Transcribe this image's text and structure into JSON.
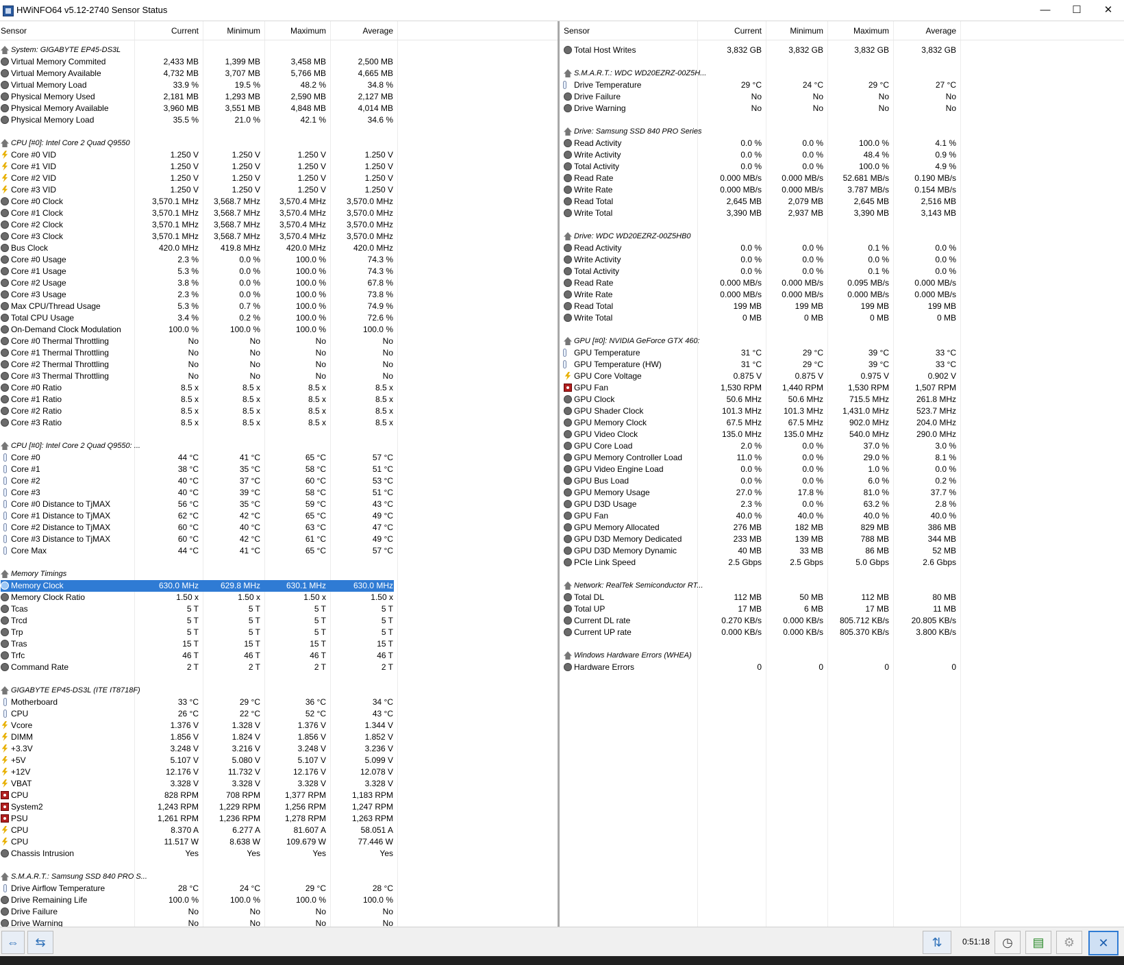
{
  "window": {
    "title": "HWiNFO64 v5.12-2740 Sensor Status",
    "minimize": "—",
    "maximize": "☐",
    "close": "✕"
  },
  "columns": {
    "sensor": "Sensor",
    "current": "Current",
    "minimum": "Minimum",
    "maximum": "Maximum",
    "average": "Average"
  },
  "left": [
    {
      "t": "g",
      "n": "System: GIGABYTE EP45-DS3L"
    },
    {
      "i": "circle",
      "n": "Virtual Memory Commited",
      "v": [
        "2,433 MB",
        "1,399 MB",
        "3,458 MB",
        "2,500 MB"
      ]
    },
    {
      "i": "circle",
      "n": "Virtual Memory Available",
      "v": [
        "4,732 MB",
        "3,707 MB",
        "5,766 MB",
        "4,665 MB"
      ]
    },
    {
      "i": "circle",
      "n": "Virtual Memory Load",
      "v": [
        "33.9 %",
        "19.5 %",
        "48.2 %",
        "34.8 %"
      ]
    },
    {
      "i": "circle",
      "n": "Physical Memory Used",
      "v": [
        "2,181 MB",
        "1,293 MB",
        "2,590 MB",
        "2,127 MB"
      ]
    },
    {
      "i": "circle",
      "n": "Physical Memory Available",
      "v": [
        "3,960 MB",
        "3,551 MB",
        "4,848 MB",
        "4,014 MB"
      ]
    },
    {
      "i": "circle",
      "n": "Physical Memory Load",
      "v": [
        "35.5 %",
        "21.0 %",
        "42.1 %",
        "34.6 %"
      ]
    },
    {
      "t": "b"
    },
    {
      "t": "g",
      "n": "CPU [#0]: Intel Core 2 Quad Q9550"
    },
    {
      "i": "bolt",
      "n": "Core #0 VID",
      "v": [
        "1.250 V",
        "1.250 V",
        "1.250 V",
        "1.250 V"
      ]
    },
    {
      "i": "bolt",
      "n": "Core #1 VID",
      "v": [
        "1.250 V",
        "1.250 V",
        "1.250 V",
        "1.250 V"
      ]
    },
    {
      "i": "bolt",
      "n": "Core #2 VID",
      "v": [
        "1.250 V",
        "1.250 V",
        "1.250 V",
        "1.250 V"
      ]
    },
    {
      "i": "bolt",
      "n": "Core #3 VID",
      "v": [
        "1.250 V",
        "1.250 V",
        "1.250 V",
        "1.250 V"
      ]
    },
    {
      "i": "circle",
      "n": "Core #0 Clock",
      "v": [
        "3,570.1 MHz",
        "3,568.7 MHz",
        "3,570.4 MHz",
        "3,570.0 MHz"
      ]
    },
    {
      "i": "circle",
      "n": "Core #1 Clock",
      "v": [
        "3,570.1 MHz",
        "3,568.7 MHz",
        "3,570.4 MHz",
        "3,570.0 MHz"
      ]
    },
    {
      "i": "circle",
      "n": "Core #2 Clock",
      "v": [
        "3,570.1 MHz",
        "3,568.7 MHz",
        "3,570.4 MHz",
        "3,570.0 MHz"
      ]
    },
    {
      "i": "circle",
      "n": "Core #3 Clock",
      "v": [
        "3,570.1 MHz",
        "3,568.7 MHz",
        "3,570.4 MHz",
        "3,570.0 MHz"
      ]
    },
    {
      "i": "circle",
      "n": "Bus Clock",
      "v": [
        "420.0 MHz",
        "419.8 MHz",
        "420.0 MHz",
        "420.0 MHz"
      ]
    },
    {
      "i": "circle",
      "n": "Core #0 Usage",
      "v": [
        "2.3 %",
        "0.0 %",
        "100.0 %",
        "74.3 %"
      ]
    },
    {
      "i": "circle",
      "n": "Core #1 Usage",
      "v": [
        "5.3 %",
        "0.0 %",
        "100.0 %",
        "74.3 %"
      ]
    },
    {
      "i": "circle",
      "n": "Core #2 Usage",
      "v": [
        "3.8 %",
        "0.0 %",
        "100.0 %",
        "67.8 %"
      ]
    },
    {
      "i": "circle",
      "n": "Core #3 Usage",
      "v": [
        "2.3 %",
        "0.0 %",
        "100.0 %",
        "73.8 %"
      ]
    },
    {
      "i": "circle",
      "n": "Max CPU/Thread Usage",
      "v": [
        "5.3 %",
        "0.7 %",
        "100.0 %",
        "74.9 %"
      ]
    },
    {
      "i": "circle",
      "n": "Total CPU Usage",
      "v": [
        "3.4 %",
        "0.2 %",
        "100.0 %",
        "72.6 %"
      ]
    },
    {
      "i": "circle",
      "n": "On-Demand Clock Modulation",
      "v": [
        "100.0 %",
        "100.0 %",
        "100.0 %",
        "100.0 %"
      ]
    },
    {
      "i": "circle",
      "n": "Core #0 Thermal Throttling",
      "v": [
        "No",
        "No",
        "No",
        "No"
      ]
    },
    {
      "i": "circle",
      "n": "Core #1 Thermal Throttling",
      "v": [
        "No",
        "No",
        "No",
        "No"
      ]
    },
    {
      "i": "circle",
      "n": "Core #2 Thermal Throttling",
      "v": [
        "No",
        "No",
        "No",
        "No"
      ]
    },
    {
      "i": "circle",
      "n": "Core #3 Thermal Throttling",
      "v": [
        "No",
        "No",
        "No",
        "No"
      ]
    },
    {
      "i": "circle",
      "n": "Core #0 Ratio",
      "v": [
        "8.5 x",
        "8.5 x",
        "8.5 x",
        "8.5 x"
      ]
    },
    {
      "i": "circle",
      "n": "Core #1 Ratio",
      "v": [
        "8.5 x",
        "8.5 x",
        "8.5 x",
        "8.5 x"
      ]
    },
    {
      "i": "circle",
      "n": "Core #2 Ratio",
      "v": [
        "8.5 x",
        "8.5 x",
        "8.5 x",
        "8.5 x"
      ]
    },
    {
      "i": "circle",
      "n": "Core #3 Ratio",
      "v": [
        "8.5 x",
        "8.5 x",
        "8.5 x",
        "8.5 x"
      ]
    },
    {
      "t": "b"
    },
    {
      "t": "g",
      "n": "CPU [#0]: Intel Core 2 Quad Q9550: ..."
    },
    {
      "i": "therm",
      "n": "Core #0",
      "v": [
        "44 °C",
        "41 °C",
        "65 °C",
        "57 °C"
      ]
    },
    {
      "i": "therm",
      "n": "Core #1",
      "v": [
        "38 °C",
        "35 °C",
        "58 °C",
        "51 °C"
      ]
    },
    {
      "i": "therm",
      "n": "Core #2",
      "v": [
        "40 °C",
        "37 °C",
        "60 °C",
        "53 °C"
      ]
    },
    {
      "i": "therm",
      "n": "Core #3",
      "v": [
        "40 °C",
        "39 °C",
        "58 °C",
        "51 °C"
      ]
    },
    {
      "i": "therm",
      "n": "Core #0 Distance to TjMAX",
      "v": [
        "56 °C",
        "35 °C",
        "59 °C",
        "43 °C"
      ]
    },
    {
      "i": "therm",
      "n": "Core #1 Distance to TjMAX",
      "v": [
        "62 °C",
        "42 °C",
        "65 °C",
        "49 °C"
      ]
    },
    {
      "i": "therm",
      "n": "Core #2 Distance to TjMAX",
      "v": [
        "60 °C",
        "40 °C",
        "63 °C",
        "47 °C"
      ]
    },
    {
      "i": "therm",
      "n": "Core #3 Distance to TjMAX",
      "v": [
        "60 °C",
        "42 °C",
        "61 °C",
        "49 °C"
      ]
    },
    {
      "i": "therm",
      "n": "Core Max",
      "v": [
        "44 °C",
        "41 °C",
        "65 °C",
        "57 °C"
      ]
    },
    {
      "t": "b"
    },
    {
      "t": "g",
      "n": "Memory Timings"
    },
    {
      "i": "sel",
      "n": "Memory Clock",
      "v": [
        "630.0 MHz",
        "629.8 MHz",
        "630.1 MHz",
        "630.0 MHz"
      ],
      "sel": true
    },
    {
      "i": "circle",
      "n": "Memory Clock Ratio",
      "v": [
        "1.50 x",
        "1.50 x",
        "1.50 x",
        "1.50 x"
      ]
    },
    {
      "i": "circle",
      "n": "Tcas",
      "v": [
        "5 T",
        "5 T",
        "5 T",
        "5 T"
      ]
    },
    {
      "i": "circle",
      "n": "Trcd",
      "v": [
        "5 T",
        "5 T",
        "5 T",
        "5 T"
      ]
    },
    {
      "i": "circle",
      "n": "Trp",
      "v": [
        "5 T",
        "5 T",
        "5 T",
        "5 T"
      ]
    },
    {
      "i": "circle",
      "n": "Tras",
      "v": [
        "15 T",
        "15 T",
        "15 T",
        "15 T"
      ]
    },
    {
      "i": "circle",
      "n": "Trfc",
      "v": [
        "46 T",
        "46 T",
        "46 T",
        "46 T"
      ]
    },
    {
      "i": "circle",
      "n": "Command Rate",
      "v": [
        "2 T",
        "2 T",
        "2 T",
        "2 T"
      ]
    },
    {
      "t": "b"
    },
    {
      "t": "g",
      "n": "GIGABYTE EP45-DS3L (ITE IT8718F)"
    },
    {
      "i": "therm",
      "n": "Motherboard",
      "v": [
        "33 °C",
        "29 °C",
        "36 °C",
        "34 °C"
      ]
    },
    {
      "i": "therm",
      "n": "CPU",
      "v": [
        "26 °C",
        "22 °C",
        "52 °C",
        "43 °C"
      ]
    },
    {
      "i": "bolt",
      "n": "Vcore",
      "v": [
        "1.376 V",
        "1.328 V",
        "1.376 V",
        "1.344 V"
      ]
    },
    {
      "i": "bolt",
      "n": "DIMM",
      "v": [
        "1.856 V",
        "1.824 V",
        "1.856 V",
        "1.852 V"
      ]
    },
    {
      "i": "bolt",
      "n": "+3.3V",
      "v": [
        "3.248 V",
        "3.216 V",
        "3.248 V",
        "3.236 V"
      ]
    },
    {
      "i": "bolt",
      "n": "+5V",
      "v": [
        "5.107 V",
        "5.080 V",
        "5.107 V",
        "5.099 V"
      ]
    },
    {
      "i": "bolt",
      "n": "+12V",
      "v": [
        "12.176 V",
        "11.732 V",
        "12.176 V",
        "12.078 V"
      ]
    },
    {
      "i": "bolt",
      "n": "VBAT",
      "v": [
        "3.328 V",
        "3.328 V",
        "3.328 V",
        "3.328 V"
      ]
    },
    {
      "i": "fan",
      "n": "CPU",
      "v": [
        "828 RPM",
        "708 RPM",
        "1,377 RPM",
        "1,183 RPM"
      ]
    },
    {
      "i": "fan",
      "n": "System2",
      "v": [
        "1,243 RPM",
        "1,229 RPM",
        "1,256 RPM",
        "1,247 RPM"
      ]
    },
    {
      "i": "fan",
      "n": "PSU",
      "v": [
        "1,261 RPM",
        "1,236 RPM",
        "1,278 RPM",
        "1,263 RPM"
      ]
    },
    {
      "i": "bolt",
      "n": "CPU",
      "v": [
        "8.370 A",
        "6.277 A",
        "81.607 A",
        "58.051 A"
      ]
    },
    {
      "i": "bolt",
      "n": "CPU",
      "v": [
        "11.517 W",
        "8.638 W",
        "109.679 W",
        "77.446 W"
      ]
    },
    {
      "i": "circle",
      "n": "Chassis Intrusion",
      "v": [
        "Yes",
        "Yes",
        "Yes",
        "Yes"
      ]
    },
    {
      "t": "b"
    },
    {
      "t": "g",
      "n": "S.M.A.R.T.: Samsung SSD 840 PRO S..."
    },
    {
      "i": "therm",
      "n": "Drive Airflow Temperature",
      "v": [
        "28 °C",
        "24 °C",
        "29 °C",
        "28 °C"
      ]
    },
    {
      "i": "circle",
      "n": "Drive Remaining Life",
      "v": [
        "100.0 %",
        "100.0 %",
        "100.0 %",
        "100.0 %"
      ]
    },
    {
      "i": "circle",
      "n": "Drive Failure",
      "v": [
        "No",
        "No",
        "No",
        "No"
      ]
    },
    {
      "i": "circle",
      "n": "Drive Warning",
      "v": [
        "No",
        "No",
        "No",
        "No"
      ]
    }
  ],
  "right": [
    {
      "i": "circle",
      "n": "Total Host Writes",
      "v": [
        "3,832 GB",
        "3,832 GB",
        "3,832 GB",
        "3,832 GB"
      ]
    },
    {
      "t": "b"
    },
    {
      "t": "g",
      "n": "S.M.A.R.T.: WDC WD20EZRZ-00Z5H..."
    },
    {
      "i": "therm",
      "n": "Drive Temperature",
      "v": [
        "29 °C",
        "24 °C",
        "29 °C",
        "27 °C"
      ]
    },
    {
      "i": "circle",
      "n": "Drive Failure",
      "v": [
        "No",
        "No",
        "No",
        "No"
      ]
    },
    {
      "i": "circle",
      "n": "Drive Warning",
      "v": [
        "No",
        "No",
        "No",
        "No"
      ]
    },
    {
      "t": "b"
    },
    {
      "t": "g",
      "n": "Drive: Samsung SSD 840 PRO Series"
    },
    {
      "i": "circle",
      "n": "Read Activity",
      "v": [
        "0.0 %",
        "0.0 %",
        "100.0 %",
        "4.1 %"
      ]
    },
    {
      "i": "circle",
      "n": "Write Activity",
      "v": [
        "0.0 %",
        "0.0 %",
        "48.4 %",
        "0.9 %"
      ]
    },
    {
      "i": "circle",
      "n": "Total Activity",
      "v": [
        "0.0 %",
        "0.0 %",
        "100.0 %",
        "4.9 %"
      ]
    },
    {
      "i": "circle",
      "n": "Read Rate",
      "v": [
        "0.000 MB/s",
        "0.000 MB/s",
        "52.681 MB/s",
        "0.190 MB/s"
      ]
    },
    {
      "i": "circle",
      "n": "Write Rate",
      "v": [
        "0.000 MB/s",
        "0.000 MB/s",
        "3.787 MB/s",
        "0.154 MB/s"
      ]
    },
    {
      "i": "circle",
      "n": "Read Total",
      "v": [
        "2,645 MB",
        "2,079 MB",
        "2,645 MB",
        "2,516 MB"
      ]
    },
    {
      "i": "circle",
      "n": "Write Total",
      "v": [
        "3,390 MB",
        "2,937 MB",
        "3,390 MB",
        "3,143 MB"
      ]
    },
    {
      "t": "b"
    },
    {
      "t": "g",
      "n": "Drive: WDC WD20EZRZ-00Z5HB0"
    },
    {
      "i": "circle",
      "n": "Read Activity",
      "v": [
        "0.0 %",
        "0.0 %",
        "0.1 %",
        "0.0 %"
      ]
    },
    {
      "i": "circle",
      "n": "Write Activity",
      "v": [
        "0.0 %",
        "0.0 %",
        "0.0 %",
        "0.0 %"
      ]
    },
    {
      "i": "circle",
      "n": "Total Activity",
      "v": [
        "0.0 %",
        "0.0 %",
        "0.1 %",
        "0.0 %"
      ]
    },
    {
      "i": "circle",
      "n": "Read Rate",
      "v": [
        "0.000 MB/s",
        "0.000 MB/s",
        "0.095 MB/s",
        "0.000 MB/s"
      ]
    },
    {
      "i": "circle",
      "n": "Write Rate",
      "v": [
        "0.000 MB/s",
        "0.000 MB/s",
        "0.000 MB/s",
        "0.000 MB/s"
      ]
    },
    {
      "i": "circle",
      "n": "Read Total",
      "v": [
        "199 MB",
        "199 MB",
        "199 MB",
        "199 MB"
      ]
    },
    {
      "i": "circle",
      "n": "Write Total",
      "v": [
        "0 MB",
        "0 MB",
        "0 MB",
        "0 MB"
      ]
    },
    {
      "t": "b"
    },
    {
      "t": "g",
      "n": "GPU [#0]: NVIDIA GeForce GTX 460:"
    },
    {
      "i": "therm",
      "n": "GPU Temperature",
      "v": [
        "31 °C",
        "29 °C",
        "39 °C",
        "33 °C"
      ]
    },
    {
      "i": "therm",
      "n": "GPU Temperature (HW)",
      "v": [
        "31 °C",
        "29 °C",
        "39 °C",
        "33 °C"
      ]
    },
    {
      "i": "bolt",
      "n": "GPU Core Voltage",
      "v": [
        "0.875 V",
        "0.875 V",
        "0.975 V",
        "0.902 V"
      ]
    },
    {
      "i": "fan",
      "n": "GPU Fan",
      "v": [
        "1,530 RPM",
        "1,440 RPM",
        "1,530 RPM",
        "1,507 RPM"
      ]
    },
    {
      "i": "circle",
      "n": "GPU Clock",
      "v": [
        "50.6 MHz",
        "50.6 MHz",
        "715.5 MHz",
        "261.8 MHz"
      ]
    },
    {
      "i": "circle",
      "n": "GPU Shader Clock",
      "v": [
        "101.3 MHz",
        "101.3 MHz",
        "1,431.0 MHz",
        "523.7 MHz"
      ]
    },
    {
      "i": "circle",
      "n": "GPU Memory Clock",
      "v": [
        "67.5 MHz",
        "67.5 MHz",
        "902.0 MHz",
        "204.0 MHz"
      ]
    },
    {
      "i": "circle",
      "n": "GPU Video Clock",
      "v": [
        "135.0 MHz",
        "135.0 MHz",
        "540.0 MHz",
        "290.0 MHz"
      ]
    },
    {
      "i": "circle",
      "n": "GPU Core Load",
      "v": [
        "2.0 %",
        "0.0 %",
        "37.0 %",
        "3.0 %"
      ]
    },
    {
      "i": "circle",
      "n": "GPU Memory Controller Load",
      "v": [
        "11.0 %",
        "0.0 %",
        "29.0 %",
        "8.1 %"
      ]
    },
    {
      "i": "circle",
      "n": "GPU Video Engine Load",
      "v": [
        "0.0 %",
        "0.0 %",
        "1.0 %",
        "0.0 %"
      ]
    },
    {
      "i": "circle",
      "n": "GPU Bus Load",
      "v": [
        "0.0 %",
        "0.0 %",
        "6.0 %",
        "0.2 %"
      ]
    },
    {
      "i": "circle",
      "n": "GPU Memory Usage",
      "v": [
        "27.0 %",
        "17.8 %",
        "81.0 %",
        "37.7 %"
      ]
    },
    {
      "i": "circle",
      "n": "GPU D3D Usage",
      "v": [
        "2.3 %",
        "0.0 %",
        "63.2 %",
        "2.8 %"
      ]
    },
    {
      "i": "circle",
      "n": "GPU Fan",
      "v": [
        "40.0 %",
        "40.0 %",
        "40.0 %",
        "40.0 %"
      ]
    },
    {
      "i": "circle",
      "n": "GPU Memory Allocated",
      "v": [
        "276 MB",
        "182 MB",
        "829 MB",
        "386 MB"
      ]
    },
    {
      "i": "circle",
      "n": "GPU D3D Memory Dedicated",
      "v": [
        "233 MB",
        "139 MB",
        "788 MB",
        "344 MB"
      ]
    },
    {
      "i": "circle",
      "n": "GPU D3D Memory Dynamic",
      "v": [
        "40 MB",
        "33 MB",
        "86 MB",
        "52 MB"
      ]
    },
    {
      "i": "circle",
      "n": "PCIe Link Speed",
      "v": [
        "2.5 Gbps",
        "2.5 Gbps",
        "5.0 Gbps",
        "2.6 Gbps"
      ]
    },
    {
      "t": "b"
    },
    {
      "t": "g",
      "n": "Network: RealTek Semiconductor RT..."
    },
    {
      "i": "circle",
      "n": "Total DL",
      "v": [
        "112 MB",
        "50 MB",
        "112 MB",
        "80 MB"
      ]
    },
    {
      "i": "circle",
      "n": "Total UP",
      "v": [
        "17 MB",
        "6 MB",
        "17 MB",
        "11 MB"
      ]
    },
    {
      "i": "circle",
      "n": "Current DL rate",
      "v": [
        "0.270 KB/s",
        "0.000 KB/s",
        "805.712 KB/s",
        "20.805 KB/s"
      ]
    },
    {
      "i": "circle",
      "n": "Current UP rate",
      "v": [
        "0.000 KB/s",
        "0.000 KB/s",
        "805.370 KB/s",
        "3.800 KB/s"
      ]
    },
    {
      "t": "b"
    },
    {
      "t": "g",
      "n": "Windows Hardware Errors (WHEA)"
    },
    {
      "i": "circle",
      "n": "Hardware Errors",
      "v": [
        "0",
        "0",
        "0",
        "0"
      ]
    }
  ],
  "footer": {
    "elapsed": "0:51:18",
    "btn_expand": "⇔",
    "btn_collapse": "⇆",
    "btn_network": "⇅",
    "btn_clock": "◷",
    "btn_log": "▤",
    "btn_settings": "⚙",
    "btn_close": "✕"
  }
}
